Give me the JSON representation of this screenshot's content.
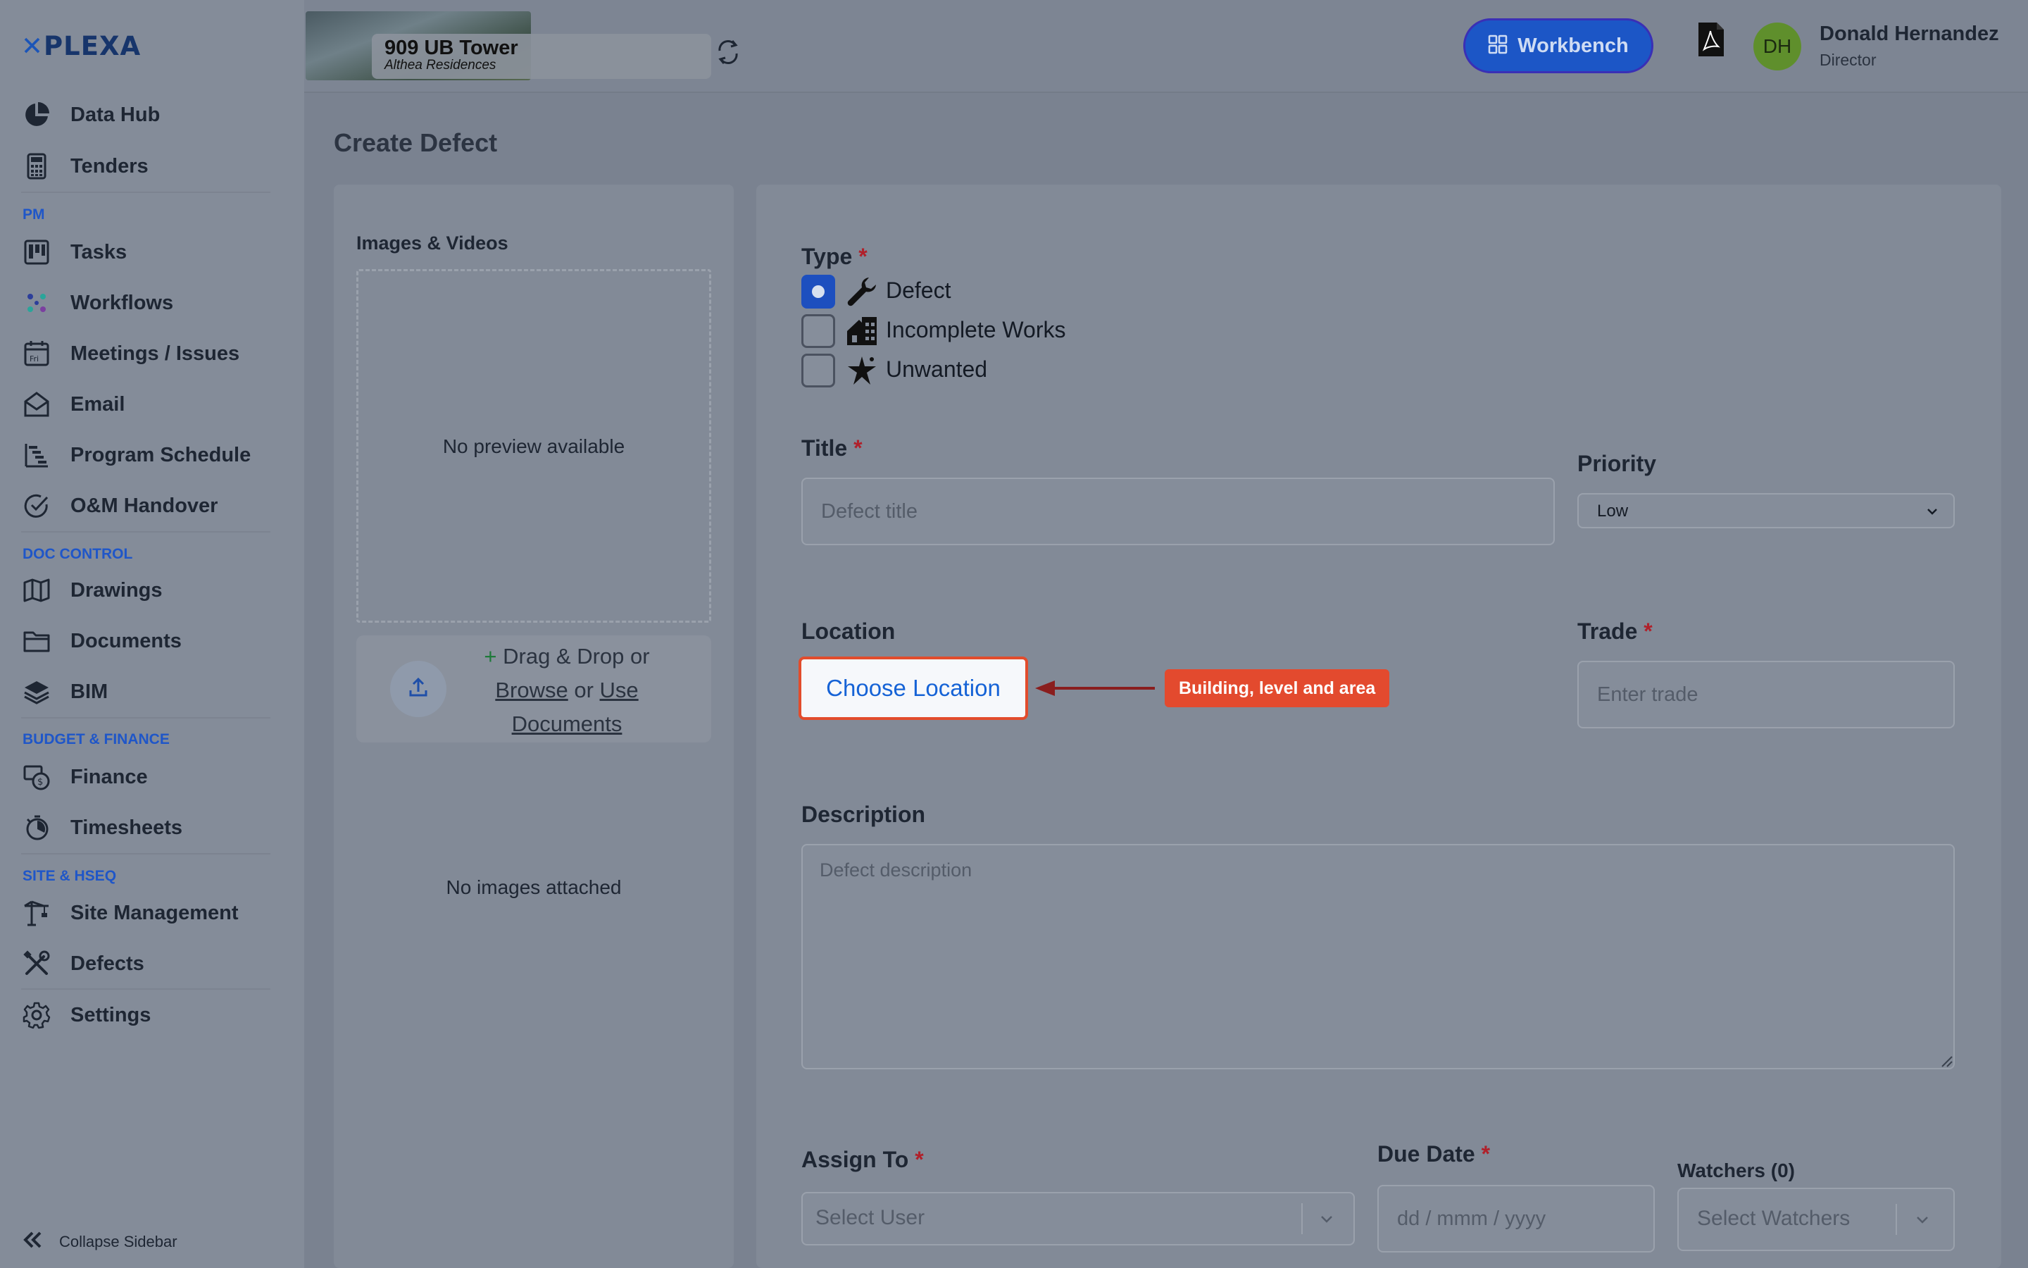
{
  "brand": {
    "logo_mark": "✕",
    "logo_text": "PLEXA"
  },
  "sidebar": {
    "items": [
      {
        "label": "Data Hub",
        "icon": "pie-chart-icon"
      },
      {
        "label": "Tenders",
        "icon": "calculator-icon"
      },
      {
        "label": "Tasks",
        "icon": "kanban-icon"
      },
      {
        "label": "Workflows",
        "icon": "workflow-icon"
      },
      {
        "label": "Meetings / Issues",
        "icon": "calendar-icon"
      },
      {
        "label": "Email",
        "icon": "mail-icon"
      },
      {
        "label": "Program Schedule",
        "icon": "gantt-icon"
      },
      {
        "label": "O&M Handover",
        "icon": "check-circle-icon"
      },
      {
        "label": "Drawings",
        "icon": "map-icon"
      },
      {
        "label": "Documents",
        "icon": "folder-icon"
      },
      {
        "label": "BIM",
        "icon": "layers-icon"
      },
      {
        "label": "Finance",
        "icon": "finance-icon"
      },
      {
        "label": "Timesheets",
        "icon": "stopwatch-icon"
      },
      {
        "label": "Site Management",
        "icon": "crane-icon"
      },
      {
        "label": "Defects",
        "icon": "tools-icon"
      },
      {
        "label": "Settings",
        "icon": "gear-icon"
      }
    ],
    "sections": {
      "pm": "PM",
      "doc_control": "DOC CONTROL",
      "budget_finance": "BUDGET & FINANCE",
      "site_hseq": "SITE & HSEQ"
    },
    "collapse_label": "Collapse Sidebar"
  },
  "header": {
    "project_name": "909 UB Tower",
    "project_subtitle": "Althea Residences",
    "workbench_label": "Workbench",
    "user": {
      "initials": "DH",
      "name": "Donald Hernandez",
      "role": "Director"
    },
    "avatar_color": "#5f8f2c"
  },
  "page": {
    "title": "Create Defect"
  },
  "media": {
    "label": "Images & Videos",
    "no_preview": "No preview available",
    "drop_plus": "+",
    "drop_text": "Drag & Drop or",
    "browse": "Browse",
    "or": "or",
    "use": "Use",
    "documents": "Documents",
    "no_images": "No images attached"
  },
  "form": {
    "type": {
      "label": "Type",
      "required_mark": "*",
      "options": [
        {
          "label": "Defect",
          "checked": true,
          "icon": "wrench-icon"
        },
        {
          "label": "Incomplete Works",
          "checked": false,
          "icon": "house-icon"
        },
        {
          "label": "Unwanted",
          "checked": false,
          "icon": "sparkle-icon"
        }
      ]
    },
    "title": {
      "label": "Title",
      "required_mark": "*",
      "placeholder": "Defect title"
    },
    "priority": {
      "label": "Priority",
      "value": "Low"
    },
    "location": {
      "label": "Location",
      "button": "Choose Location",
      "tooltip": "Building, level and area"
    },
    "trade": {
      "label": "Trade",
      "required_mark": "*",
      "placeholder": "Enter trade"
    },
    "description": {
      "label": "Description",
      "placeholder": "Defect description"
    },
    "assign_to": {
      "label": "Assign To",
      "required_mark": "*",
      "placeholder": "Select User"
    },
    "due_date": {
      "label": "Due Date",
      "required_mark": "*",
      "placeholder": "dd / mmm / yyyy"
    },
    "watchers": {
      "label": "Watchers (0)",
      "placeholder": "Select Watchers"
    }
  },
  "colors": {
    "accent": "#1c56c6",
    "highlight": "#e34a2e",
    "required": "#b0202a"
  }
}
